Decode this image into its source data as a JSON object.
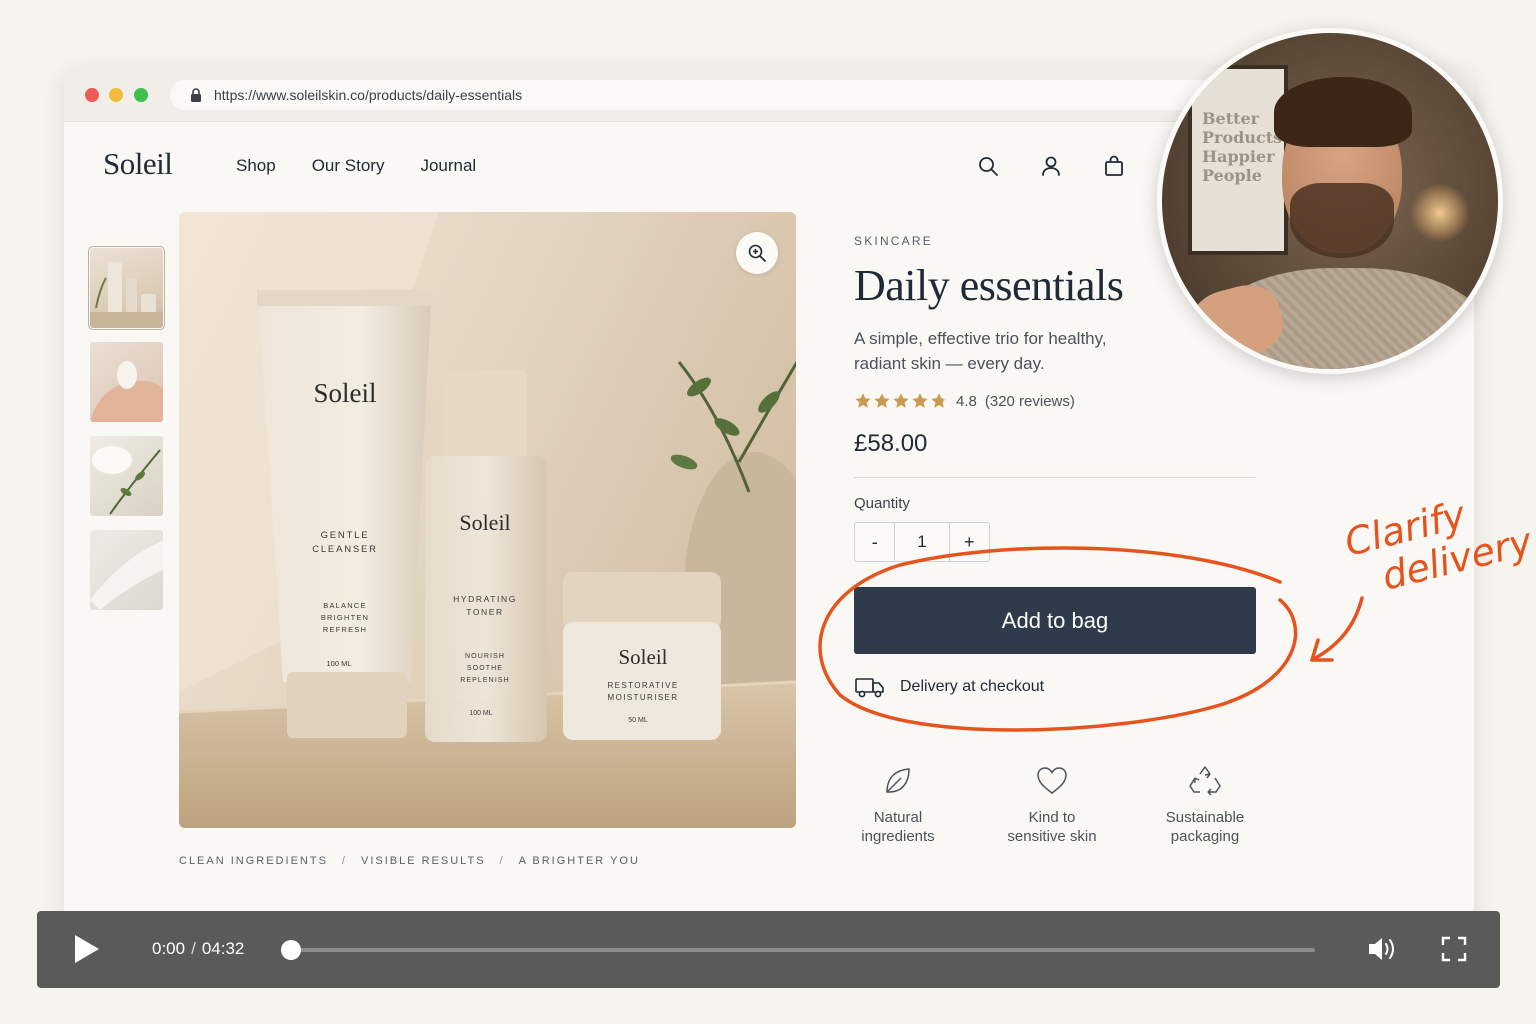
{
  "browser": {
    "url": "https://www.soleilskin.co/products/daily-essentials"
  },
  "header": {
    "logo": "Soleil",
    "nav": [
      "Shop",
      "Our Story",
      "Journal"
    ],
    "icons": [
      "search-icon",
      "account-icon",
      "bag-icon"
    ]
  },
  "gallery": {
    "thumbnail_count": 4,
    "active_index": 0,
    "hero_labels": {
      "cleanser_brand": "Soleil",
      "cleanser_name": "GENTLE\nCLEANSER",
      "cleanser_benefits": "BALANCE\nBRIGHTEN\nREFRESH",
      "cleanser_size": "100 ML",
      "toner_brand": "Soleil",
      "toner_name": "HYDRATING\nTONER",
      "toner_benefits": "NOURISH\nSOOTHE\nREPLENISH",
      "toner_size": "100 ML",
      "jar_brand": "Soleil",
      "jar_name": "RESTORATIVE\nMOISTURISER",
      "jar_size": "50 ML"
    },
    "taglines": [
      "CLEAN INGREDIENTS",
      "VISIBLE RESULTS",
      "A BRIGHTER YOU"
    ],
    "separator": "/"
  },
  "product": {
    "category": "SKINCARE",
    "title": "Daily essentials",
    "description": "A simple, effective trio for healthy, radiant skin — every day.",
    "rating": 4.8,
    "rating_text": "4.8",
    "reviews_text": "(320 reviews)",
    "price": "£58.00",
    "quantity_label": "Quantity",
    "quantity": "1",
    "decrement": "-",
    "increment": "+",
    "add_to_bag": "Add to bag",
    "delivery": "Delivery at checkout",
    "features": [
      {
        "label": "Natural\ningredients",
        "icon": "leaf-icon"
      },
      {
        "label": "Kind to\nsensitive skin",
        "icon": "heart-icon"
      },
      {
        "label": "Sustainable\npackaging",
        "icon": "recycle-icon"
      }
    ]
  },
  "webcam": {
    "poster_text": "Better\nProducts\nHappier\nPeople"
  },
  "annotation": {
    "text": "Clarify\ndelivery",
    "color": "#e5541e"
  },
  "player": {
    "current_time": "0:00",
    "duration": "04:32",
    "progress": 0
  },
  "colors": {
    "primary_button": "#2f3b4a",
    "star": "#c99a50",
    "page_bg": "#faf8f4"
  }
}
